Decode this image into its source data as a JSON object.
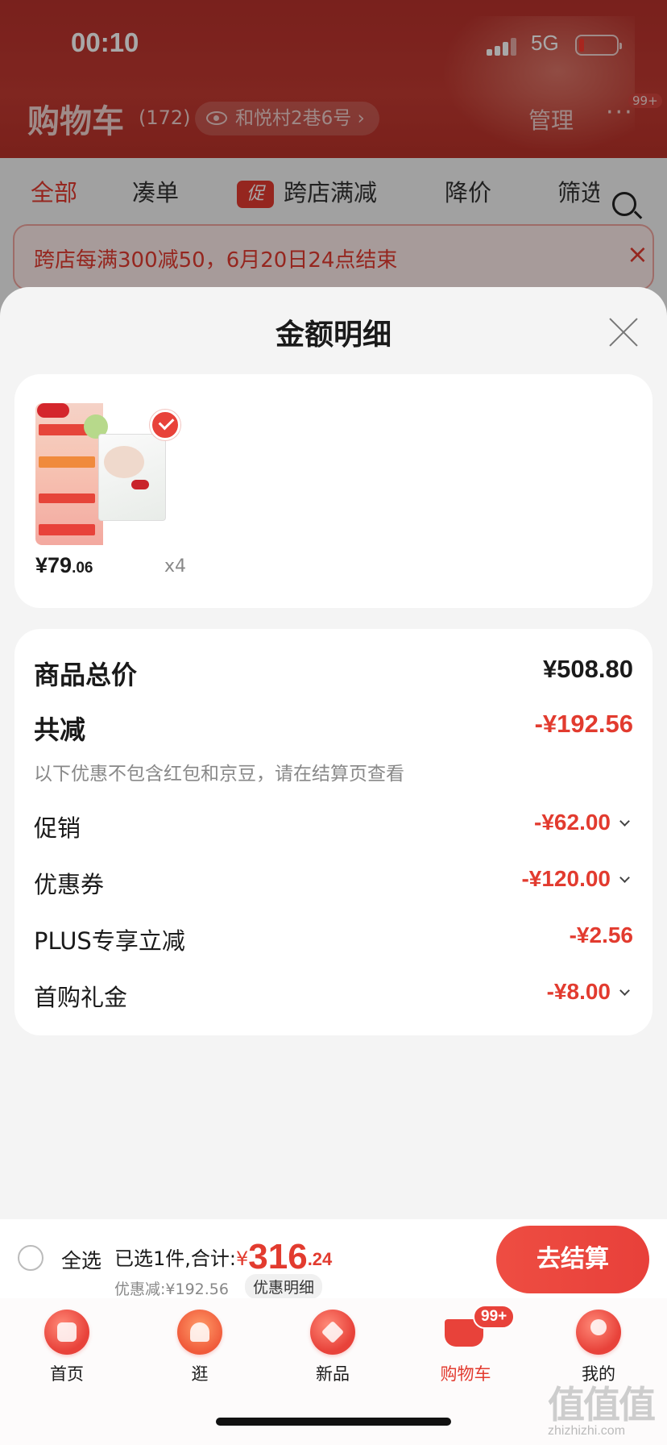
{
  "status_bar": {
    "time": "00:10",
    "network": "5G"
  },
  "header": {
    "title": "购物车",
    "count": "(172)",
    "address": "和悦村2巷6号 ›",
    "manage": "管理",
    "more": "···",
    "more_badge": "99+"
  },
  "filter_tabs": {
    "all": "全部",
    "bundle": "凑单",
    "promo_tag": "促",
    "cross_store": "跨店满减",
    "price_drop": "降价",
    "filter": "筛选"
  },
  "promo_banner": {
    "text": "跨店每满300减50，6月20日24点结束",
    "close": "×"
  },
  "sheet": {
    "title": "金额明细",
    "product": {
      "price_int": "¥79",
      "price_dec": ".06",
      "qty": "x4"
    },
    "details": {
      "total_label": "商品总价",
      "total_value": "¥508.80",
      "reduce_label": "共减",
      "reduce_value": "-¥192.56",
      "note": "以下优惠不包含红包和京豆，请在结算页查看",
      "items": [
        {
          "label": "促销",
          "value": "-¥62.00"
        },
        {
          "label": "优惠券",
          "value": "-¥120.00"
        },
        {
          "label": "PLUS专享立减",
          "value": "-¥2.56"
        },
        {
          "label": "首购礼金",
          "value": "-¥8.00"
        }
      ]
    }
  },
  "checkout": {
    "select_all": "全选",
    "selected_text": "已选1件,合计:",
    "yen": "¥",
    "total_int": "316",
    "total_dec": ".24",
    "saved_text": "优惠减:¥192.56",
    "saved_detail": "优惠明细",
    "pay_button": "去结算"
  },
  "tabbar": {
    "items": [
      {
        "label": "首页"
      },
      {
        "label": "逛"
      },
      {
        "label": "新品"
      },
      {
        "label": "购物车",
        "badge": "99+"
      },
      {
        "label": "我的"
      }
    ]
  },
  "watermark": {
    "text": "值值值",
    "sub": "zhizhizhi.com"
  },
  "colors": {
    "accent": "#e23b2f",
    "header_bg": "#c23a31"
  }
}
